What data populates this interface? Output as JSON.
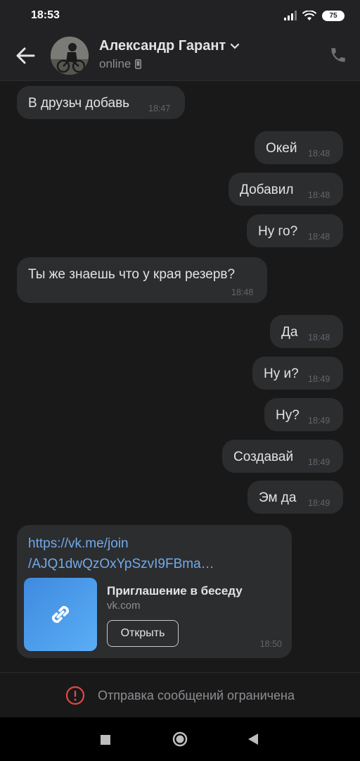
{
  "status_bar": {
    "time": "18:53",
    "battery": "75"
  },
  "header": {
    "name": "Александр Гарант",
    "status": "online"
  },
  "messages": [
    {
      "dir": "in",
      "text": "В друзьч добавь",
      "time": "18:47"
    },
    {
      "dir": "out",
      "text": "Окей",
      "time": "18:48"
    },
    {
      "dir": "out",
      "text": "Добавил",
      "time": "18:48"
    },
    {
      "dir": "out",
      "text": "Ну го?",
      "time": "18:48"
    },
    {
      "dir": "in",
      "text": "Ты же знаешь что у края резерв?",
      "time": "18:48"
    },
    {
      "dir": "out",
      "text": "Да",
      "time": "18:48"
    },
    {
      "dir": "out",
      "text": "Ну и?",
      "time": "18:49"
    },
    {
      "dir": "out",
      "text": "Ну?",
      "time": "18:49"
    },
    {
      "dir": "out",
      "text": "Создавай",
      "time": "18:49"
    },
    {
      "dir": "out",
      "text": "Эм да",
      "time": "18:49"
    }
  ],
  "link_message": {
    "url_line1": "https://vk.me/join",
    "url_line2": "/AJQ1dwQzOxYpSzvI9FBma…",
    "title": "Приглашение в беседу",
    "domain": "vk.com",
    "button": "Открыть",
    "time": "18:50"
  },
  "restriction": {
    "text": "Отправка сообщений ограничена"
  },
  "colors": {
    "accent": "#71aaeb",
    "bubble": "#2c2d2f",
    "background": "#19191a",
    "warning": "#e64646"
  }
}
